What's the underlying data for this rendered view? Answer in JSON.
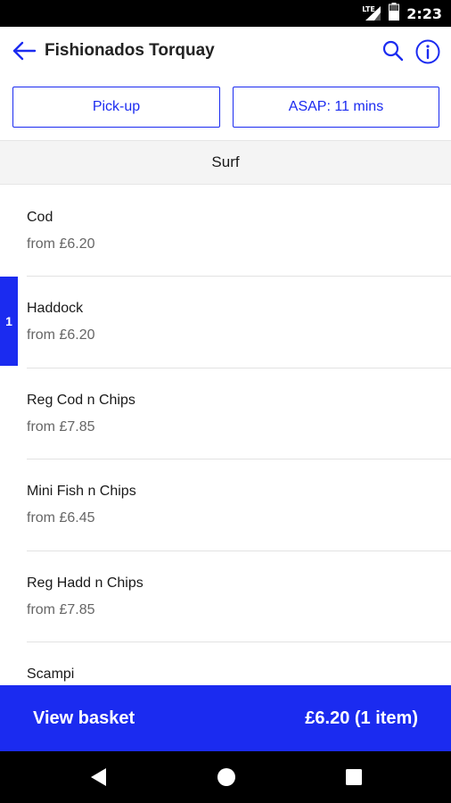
{
  "status_bar": {
    "time": "2:23",
    "network_label": "LTE"
  },
  "header": {
    "title": "Fishionados Torquay"
  },
  "order_options": {
    "pickup_label": "Pick-up",
    "time_label": "ASAP: 11 mins"
  },
  "section": {
    "title": "Surf"
  },
  "menu": {
    "items": [
      {
        "name": "Cod",
        "price": "from £6.20"
      },
      {
        "name": "Haddock",
        "price": "from £6.20",
        "quantity": "1"
      },
      {
        "name": "Reg Cod n Chips",
        "price": "from £7.85"
      },
      {
        "name": "Mini Fish n Chips",
        "price": "from £6.45"
      },
      {
        "name": "Reg Hadd n Chips",
        "price": "from £7.85"
      },
      {
        "name": "Scampi",
        "price": ""
      }
    ]
  },
  "basket": {
    "label": "View basket",
    "total": "£6.20 (1 item)"
  },
  "colors": {
    "accent": "#1b2bf0",
    "section_bg": "#f4f4f4"
  }
}
